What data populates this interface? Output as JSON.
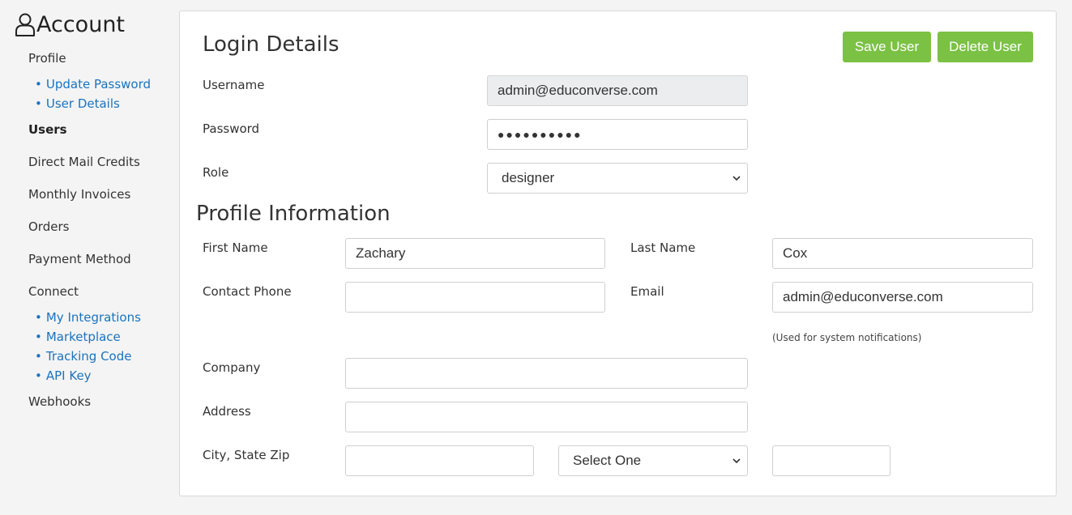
{
  "sidebar": {
    "title": "Account",
    "profile": "Profile",
    "profile_links": [
      "Update Password",
      "User Details"
    ],
    "users": "Users",
    "direct_mail_credits": "Direct Mail Credits",
    "monthly_invoices": "Monthly Invoices",
    "orders": "Orders",
    "payment_method": "Payment Method",
    "connect": "Connect",
    "connect_links": [
      "My Integrations",
      "Marketplace",
      "Tracking Code",
      "API Key"
    ],
    "webhooks": "Webhooks",
    "bullet": "•"
  },
  "login": {
    "heading": "Login Details",
    "save_label": "Save User",
    "delete_label": "Delete User",
    "username_label": "Username",
    "username_value": "admin@educonverse.com",
    "password_label": "Password",
    "password_value": "●●●●●●●●●●",
    "role_label": "Role",
    "role_value": "designer"
  },
  "profile": {
    "heading": "Profile Information",
    "first_name_label": "First Name",
    "first_name_value": "Zachary",
    "last_name_label": "Last Name",
    "last_name_value": "Cox",
    "contact_phone_label": "Contact Phone",
    "contact_phone_value": "",
    "email_label": "Email",
    "email_value": "admin@educonverse.com",
    "email_hint": "(Used for system notifications)",
    "company_label": "Company",
    "company_value": "",
    "address_label": "Address",
    "address_value": "",
    "city_state_zip_label": "City, State Zip",
    "city_value": "",
    "state_value": "Select One",
    "zip_value": ""
  },
  "colors": {
    "accent_green": "#7bc144",
    "link_blue": "#1a73c0"
  },
  "icons": {
    "account": "user-icon",
    "dropdown": "chevron-down-icon"
  }
}
